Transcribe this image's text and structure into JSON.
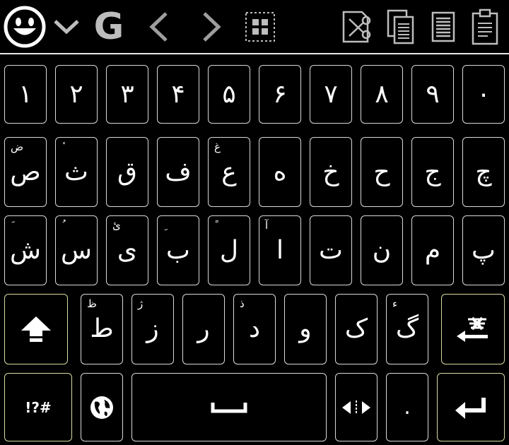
{
  "toolbar": {
    "items": [
      "emoji-icon",
      "chevron-down-icon",
      "google-icon",
      "arrow-left-icon",
      "arrow-right-icon",
      "select-all-icon",
      "cut-icon",
      "copy-icon",
      "select-text-icon",
      "paste-icon"
    ],
    "google_label": "G",
    "left_arrow": "‹",
    "right_arrow": "›"
  },
  "rows": {
    "digits": [
      "١",
      "٢",
      "٣",
      "۴",
      "۵",
      "۶",
      "٧",
      "٨",
      "٩",
      "٠"
    ],
    "row1": [
      {
        "main": "ص",
        "hint": "ض"
      },
      {
        "main": "ث",
        "hint": "ٔ"
      },
      {
        "main": "ق",
        "hint": ""
      },
      {
        "main": "ف",
        "hint": ""
      },
      {
        "main": "ع",
        "hint": "غ"
      },
      {
        "main": "ه",
        "hint": ""
      },
      {
        "main": "خ",
        "hint": ""
      },
      {
        "main": "ح",
        "hint": ""
      },
      {
        "main": "ج",
        "hint": ""
      },
      {
        "main": "چ",
        "hint": ""
      }
    ],
    "row2": [
      {
        "main": "ش",
        "hint": "َ"
      },
      {
        "main": "س",
        "hint": "ُ"
      },
      {
        "main": "ی",
        "hint": "ئ"
      },
      {
        "main": "ب",
        "hint": "ِ"
      },
      {
        "main": "ل",
        "hint": "ً"
      },
      {
        "main": "ا",
        "hint": "آ"
      },
      {
        "main": "ت",
        "hint": ""
      },
      {
        "main": "ن",
        "hint": ""
      },
      {
        "main": "م",
        "hint": ""
      },
      {
        "main": "پ",
        "hint": ""
      }
    ],
    "row3": [
      {
        "main": "ط",
        "hint": "ظ"
      },
      {
        "main": "ز",
        "hint": "ژ"
      },
      {
        "main": "ر",
        "hint": ""
      },
      {
        "main": "د",
        "hint": "ذ"
      },
      {
        "main": "و",
        "hint": ""
      },
      {
        "main": "ک",
        "hint": ""
      },
      {
        "main": "گ",
        "hint": "ء"
      }
    ]
  },
  "bottom": {
    "symbols_label": "!?#",
    "period_label": "."
  }
}
